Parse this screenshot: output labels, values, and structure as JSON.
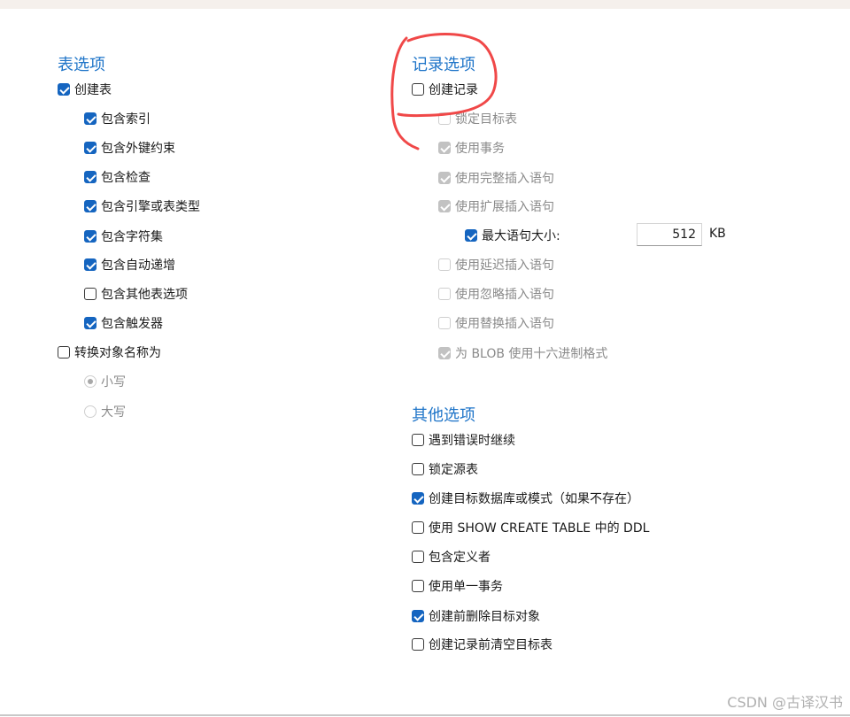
{
  "table_options": {
    "title": "表选项",
    "create_table": "创建表",
    "include_index": "包含索引",
    "include_fk": "包含外键约束",
    "include_check": "包含检查",
    "include_engine": "包含引擎或表类型",
    "include_charset": "包含字符集",
    "include_autoinc": "包含自动递增",
    "include_other": "包含其他表选项",
    "include_trigger": "包含触发器",
    "convert_names": "转换对象名称为",
    "lower": "小写",
    "upper": "大写"
  },
  "record_options": {
    "title": "记录选项",
    "create_record": "创建记录",
    "lock_target": "锁定目标表",
    "use_transaction": "使用事务",
    "complete_insert": "使用完整插入语句",
    "extended_insert": "使用扩展插入语句",
    "max_stmt_size": "最大语句大小:",
    "max_stmt_value": "512",
    "max_stmt_unit": "KB",
    "delayed_insert": "使用延迟插入语句",
    "ignore_insert": "使用忽略插入语句",
    "replace_insert": "使用替换插入语句",
    "blob_hex": "为 BLOB 使用十六进制格式"
  },
  "other_options": {
    "title": "其他选项",
    "continue_on_error": "遇到错误时继续",
    "lock_source": "锁定源表",
    "create_target_db": "创建目标数据库或模式（如果不存在）",
    "show_create_ddl": "使用 SHOW CREATE TABLE 中的 DDL",
    "include_definer": "包含定义者",
    "single_transaction": "使用单一事务",
    "drop_before_create": "创建前删除目标对象",
    "truncate_before_insert": "创建记录前清空目标表"
  },
  "annotation": {
    "color": "#f04848"
  },
  "watermark": "CSDN @古译汉书",
  "colors": {
    "accent": "#1565c0",
    "title": "#1e74c8",
    "disabled": "#c2c2c2"
  }
}
